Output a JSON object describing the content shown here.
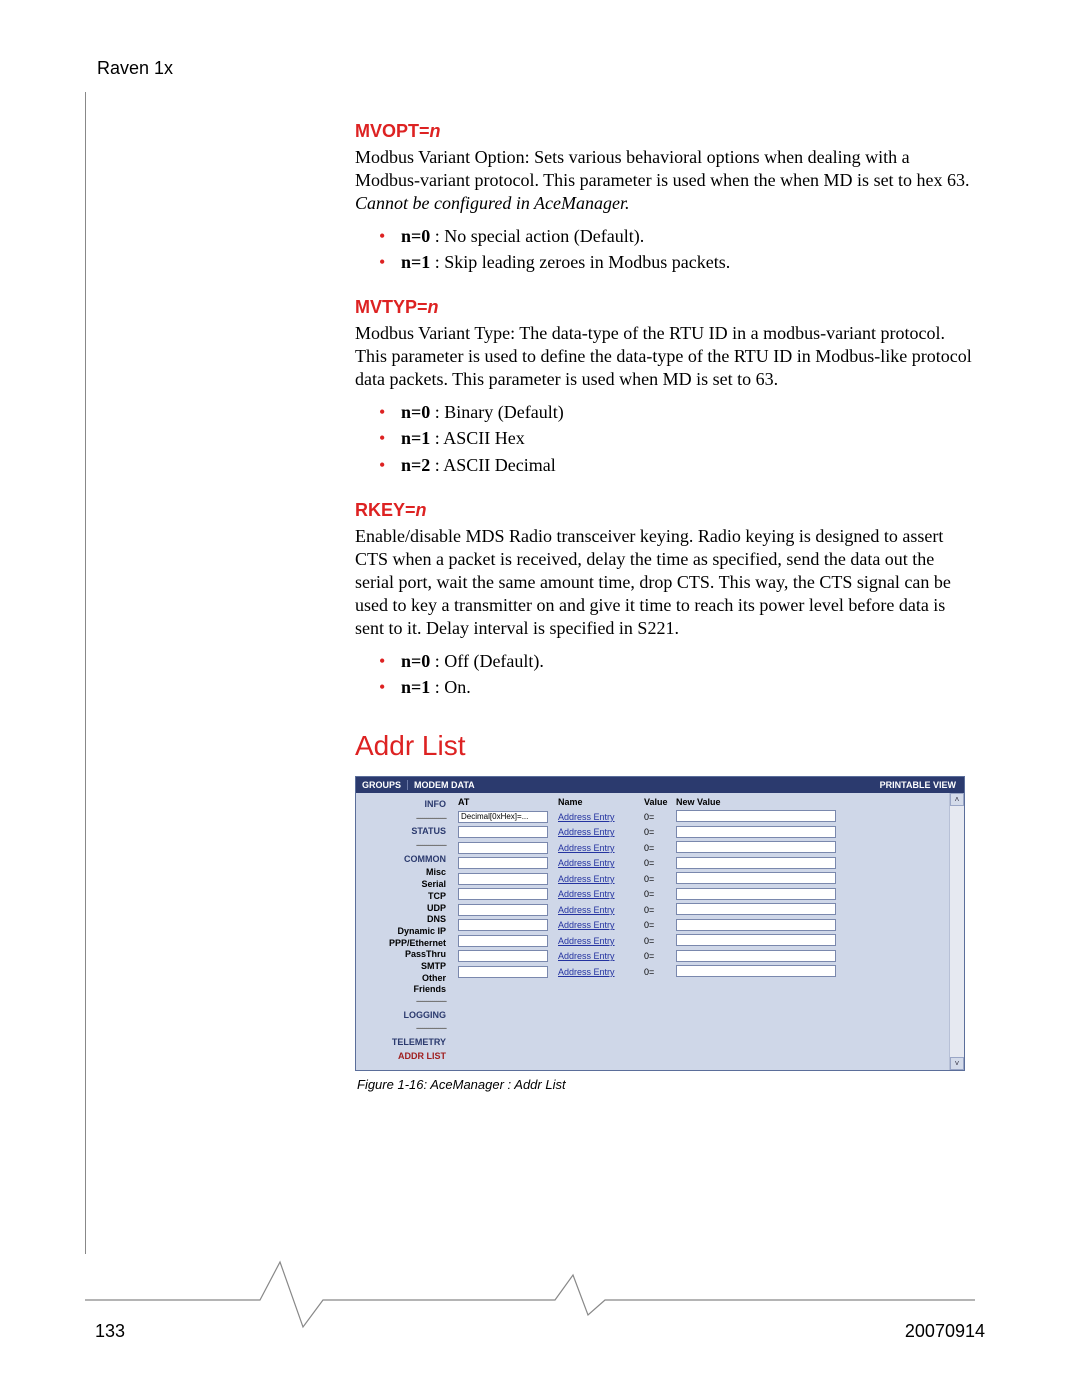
{
  "header": {
    "product": "Raven 1x"
  },
  "page": {
    "number": "133",
    "date": "20070914"
  },
  "sections": {
    "mvopt": {
      "title_pre": "MVOPT=",
      "title_param": "n",
      "desc_a": "Modbus Variant Option: Sets various behavioral options when dealing with a Modbus-variant protocol. This parameter is used when the when MD is set to hex 63. ",
      "desc_b": "Cannot be configured in AceManager.",
      "opts": [
        {
          "k": "n=0",
          "v": " : No special action (Default)."
        },
        {
          "k": "n=1",
          "v": " : Skip leading zeroes in Modbus packets."
        }
      ]
    },
    "mvtyp": {
      "title_pre": "MVTYP=",
      "title_param": "n",
      "desc": "Modbus Variant Type: The data-type of the RTU ID in a modbus-variant protocol. This parameter is used to define the data-type of the RTU ID in Modbus-like protocol data packets. This parameter is used when MD is set to 63.",
      "opts": [
        {
          "k": "n=0",
          "v": " : Binary (Default)"
        },
        {
          "k": "n=1",
          "v": " : ASCII Hex"
        },
        {
          "k": "n=2",
          "v": " : ASCII Decimal"
        }
      ]
    },
    "rkey": {
      "title_pre": "RKEY=",
      "title_param": "n",
      "desc": "Enable/disable MDS Radio transceiver keying. Radio keying is designed to assert CTS when a packet is received, delay the time as specified, send the data out the serial port, wait the same amount time, drop CTS. This way, the CTS signal can be used to key a transmitter on and give it time to reach its power level before data is sent to it. Delay interval is specified in S221.",
      "opts": [
        {
          "k": "n=0",
          "v": " : Off (Default)."
        },
        {
          "k": "n=1",
          "v": " : On."
        }
      ]
    },
    "addrlist": {
      "heading": "Addr List",
      "caption": "Figure 1-16: AceManager : Addr List"
    }
  },
  "ace": {
    "titlebar": {
      "left": "GROUPS",
      "mid": "MODEM DATA",
      "right": "PRINTABLE VIEW"
    },
    "sidebar": {
      "rule": "---------------",
      "items": {
        "info": "INFO",
        "status": "STATUS",
        "common": "COMMON",
        "misc": "Misc",
        "serial": "Serial",
        "tcp": "TCP",
        "udp": "UDP",
        "dns": "DNS",
        "dynip": "Dynamic IP",
        "ppp": "PPP/Ethernet",
        "passthru": "PassThru",
        "smtp": "SMTP",
        "other": "Other",
        "friends": "Friends",
        "logging": "LOGGING",
        "telemetry": "TELEMETRY",
        "addrlist": "ADDR LIST"
      }
    },
    "table": {
      "headers": {
        "at": "AT",
        "name": "Name",
        "value": "Value",
        "newvalue": "New Value"
      },
      "first_at": "Decimal[0xHex]=...",
      "row_name": "Address Entry",
      "row_value": "0=",
      "row_count": 11
    }
  }
}
